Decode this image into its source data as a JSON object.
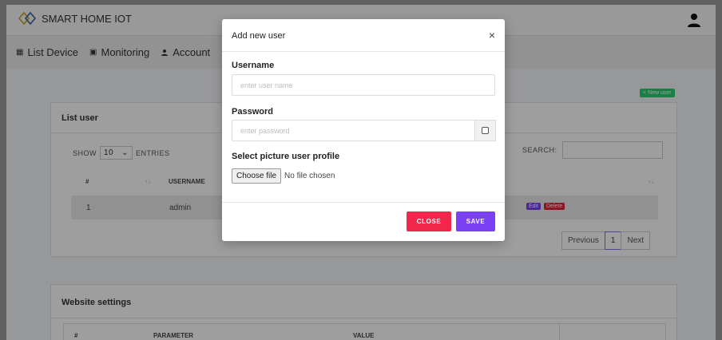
{
  "app": {
    "brand": "SMART HOME IOT"
  },
  "nav": {
    "items": [
      {
        "label": "List Device",
        "icon": "grid-icon"
      },
      {
        "label": "Monitoring",
        "icon": "monitor-icon"
      },
      {
        "label": "Account",
        "icon": "user-icon"
      }
    ]
  },
  "users_card": {
    "new_user_label": "+ New user",
    "title": "List user",
    "show_label": "SHOW",
    "entries_value": "10",
    "entries_label": "ENTRIES",
    "search_label": "SEARCH:",
    "columns": [
      "#",
      "USERNAME"
    ],
    "sort_icon": "↑↓",
    "rows": [
      {
        "index": "1",
        "username": "admin",
        "edit_label": "Edit",
        "delete_label": "Delete"
      }
    ],
    "pagination": {
      "previous": "Previous",
      "page": "1",
      "next": "Next"
    }
  },
  "settings_card": {
    "title": "Website settings",
    "columns": [
      "#",
      "PARAMETER",
      "VALUE"
    ]
  },
  "modal": {
    "title": "Add new user",
    "close_icon": "×",
    "username_label": "Username",
    "username_placeholder": "enter user name",
    "password_label": "Password",
    "password_placeholder": "enter password",
    "picture_label": "Select picture user profile",
    "file_button": "Choose file",
    "file_status": "No file chosen",
    "close_button": "CLOSE",
    "save_button": "SAVE"
  },
  "colors": {
    "primary": "#7b3ff2",
    "danger": "#f0274a",
    "success": "#2ecc71"
  }
}
